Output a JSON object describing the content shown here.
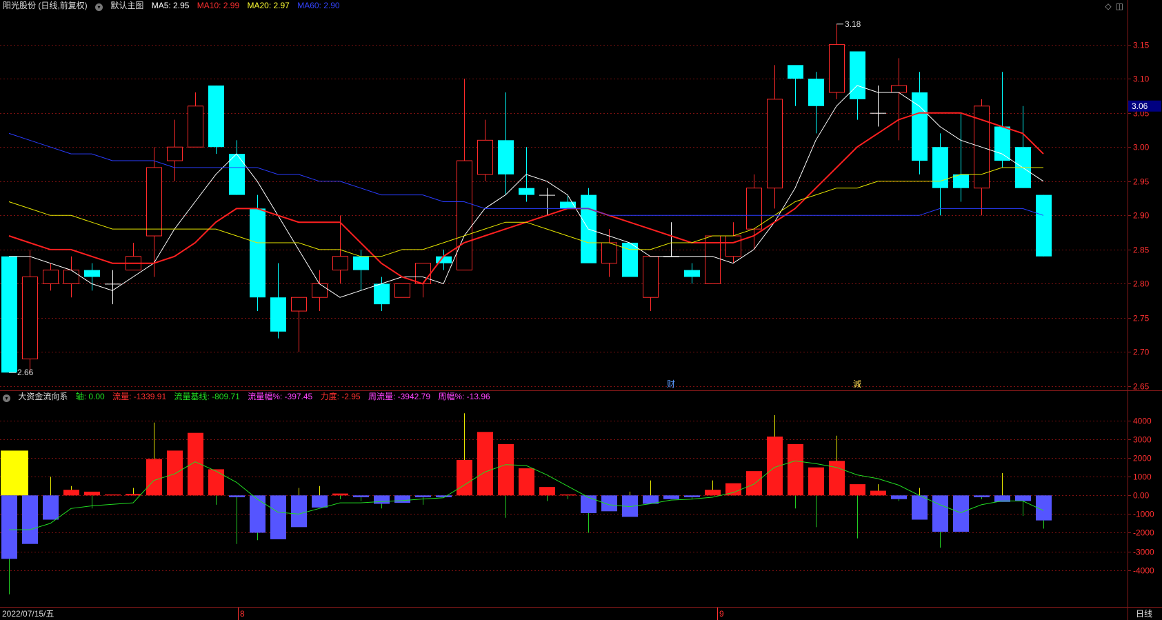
{
  "header": {
    "stock_label": "阳光股份 (日线,前复权)",
    "main_label": "默认主图",
    "ma5": "MA5: 2.95",
    "ma10": "MA10: 2.99",
    "ma20": "MA20: 2.97",
    "ma60": "MA60: 2.90"
  },
  "sub_header": {
    "title": "大资金流向系",
    "axis": "轴: 0.00",
    "flow": "流量: -1339.91",
    "baseline": "流量基线: -809.71",
    "flow_pct": "流量幅%: -397.45",
    "strength": "力度: -2.95",
    "weekly_flow": "周流量: -3942.79",
    "weekly_pct": "周幅%: -13.96"
  },
  "colors": {
    "up": "#ff2a2a",
    "down": "#00ffff",
    "ma5": "#ffffff",
    "ma10": "#ff2020",
    "ma20": "#e6e600",
    "ma60": "#2a3cff",
    "flow_pos": "#ff1a1a",
    "flow_neg": "#5555ff",
    "baseline": "#22dd22",
    "grid": "#7a1010"
  },
  "chart_data": [
    {
      "type": "candlestick",
      "yticks": [
        "3.15",
        "3.10",
        "3.05",
        "3.00",
        "2.95",
        "2.90",
        "2.85",
        "2.80",
        "2.75",
        "2.70",
        "2.65"
      ],
      "ylim": [
        2.645,
        3.195
      ],
      "current_price": "3.06",
      "high_marker": "3.18",
      "low_marker": "2.66",
      "event_labels": [
        {
          "index": 32,
          "text": "财"
        },
        {
          "index": 41,
          "text": "減"
        }
      ],
      "candles": [
        [
          2.84,
          2.84,
          2.67,
          2.67
        ],
        [
          2.69,
          2.85,
          2.67,
          2.81
        ],
        [
          2.8,
          2.83,
          2.79,
          2.82
        ],
        [
          2.8,
          2.84,
          2.78,
          2.82
        ],
        [
          2.82,
          2.83,
          2.79,
          2.81
        ],
        [
          2.8,
          2.82,
          2.77,
          2.8
        ],
        [
          2.82,
          2.86,
          2.82,
          2.84
        ],
        [
          2.87,
          3.0,
          2.81,
          2.97
        ],
        [
          2.98,
          3.04,
          2.95,
          3.0
        ],
        [
          3.0,
          3.08,
          3.0,
          3.06
        ],
        [
          3.09,
          3.09,
          2.99,
          3.0
        ],
        [
          2.99,
          3.01,
          2.93,
          2.93
        ],
        [
          2.91,
          2.93,
          2.76,
          2.78
        ],
        [
          2.78,
          2.83,
          2.72,
          2.73
        ],
        [
          2.76,
          2.78,
          2.7,
          2.78
        ],
        [
          2.78,
          2.82,
          2.76,
          2.8
        ],
        [
          2.82,
          2.9,
          2.8,
          2.84
        ],
        [
          2.84,
          2.85,
          2.79,
          2.82
        ],
        [
          2.8,
          2.81,
          2.76,
          2.77
        ],
        [
          2.78,
          2.8,
          2.78,
          2.8
        ],
        [
          2.8,
          2.83,
          2.78,
          2.83
        ],
        [
          2.84,
          2.85,
          2.82,
          2.83
        ],
        [
          2.82,
          3.1,
          2.82,
          2.98
        ],
        [
          2.96,
          3.04,
          2.95,
          3.01
        ],
        [
          3.01,
          3.08,
          2.93,
          2.96
        ],
        [
          2.94,
          3.0,
          2.92,
          2.93
        ],
        [
          2.93,
          2.94,
          2.9,
          2.93
        ],
        [
          2.92,
          2.93,
          2.91,
          2.91
        ],
        [
          2.93,
          2.94,
          2.91,
          2.83
        ],
        [
          2.83,
          2.88,
          2.81,
          2.86
        ],
        [
          2.86,
          2.86,
          2.81,
          2.81
        ],
        [
          2.78,
          2.84,
          2.76,
          2.84
        ],
        [
          2.84,
          2.89,
          2.84,
          2.84
        ],
        [
          2.82,
          2.83,
          2.8,
          2.81
        ],
        [
          2.8,
          2.84,
          2.8,
          2.87
        ],
        [
          2.84,
          2.89,
          2.83,
          2.87
        ],
        [
          2.88,
          2.96,
          2.85,
          2.94
        ],
        [
          2.94,
          3.12,
          2.91,
          3.07
        ],
        [
          3.12,
          3.11,
          3.06,
          3.1
        ],
        [
          3.1,
          3.11,
          3.02,
          3.06
        ],
        [
          3.08,
          3.18,
          3.07,
          3.15
        ],
        [
          3.14,
          3.14,
          3.04,
          3.07
        ],
        [
          3.05,
          3.09,
          3.03,
          3.05
        ],
        [
          3.08,
          3.13,
          3.01,
          3.09
        ],
        [
          3.08,
          3.11,
          2.96,
          2.98
        ],
        [
          3.0,
          3.02,
          2.9,
          2.94
        ],
        [
          2.96,
          3.05,
          2.92,
          2.94
        ],
        [
          2.94,
          3.07,
          2.9,
          3.06
        ],
        [
          3.03,
          3.11,
          2.97,
          2.98
        ],
        [
          3.0,
          3.06,
          2.94,
          2.94
        ],
        [
          2.93,
          2.93,
          2.84,
          2.84
        ]
      ],
      "series": [
        {
          "name": "MA5",
          "values": [
            2.84,
            2.84,
            2.83,
            2.82,
            2.8,
            2.79,
            2.81,
            2.83,
            2.88,
            2.92,
            2.96,
            2.99,
            2.95,
            2.9,
            2.85,
            2.8,
            2.78,
            2.79,
            2.8,
            2.81,
            2.81,
            2.8,
            2.87,
            2.91,
            2.93,
            2.96,
            2.95,
            2.93,
            2.88,
            2.87,
            2.86,
            2.84,
            2.84,
            2.84,
            2.84,
            2.83,
            2.85,
            2.89,
            2.94,
            3.01,
            3.06,
            3.09,
            3.08,
            3.08,
            3.06,
            3.03,
            3.01,
            3.0,
            2.99,
            2.97,
            2.95
          ]
        },
        {
          "name": "MA10",
          "values": [
            2.87,
            2.86,
            2.85,
            2.85,
            2.84,
            2.83,
            2.83,
            2.83,
            2.84,
            2.86,
            2.89,
            2.91,
            2.91,
            2.9,
            2.89,
            2.89,
            2.89,
            2.86,
            2.83,
            2.81,
            2.8,
            2.84,
            2.86,
            2.87,
            2.88,
            2.89,
            2.9,
            2.91,
            2.91,
            2.9,
            2.89,
            2.88,
            2.87,
            2.86,
            2.86,
            2.86,
            2.87,
            2.89,
            2.91,
            2.94,
            2.97,
            3.0,
            3.02,
            3.04,
            3.05,
            3.05,
            3.05,
            3.04,
            3.03,
            3.02,
            2.99
          ]
        },
        {
          "name": "MA20",
          "values": [
            2.92,
            2.91,
            2.9,
            2.9,
            2.89,
            2.88,
            2.88,
            2.88,
            2.88,
            2.88,
            2.88,
            2.87,
            2.86,
            2.86,
            2.86,
            2.85,
            2.85,
            2.84,
            2.84,
            2.85,
            2.85,
            2.86,
            2.87,
            2.88,
            2.89,
            2.89,
            2.88,
            2.87,
            2.86,
            2.86,
            2.85,
            2.85,
            2.86,
            2.86,
            2.87,
            2.87,
            2.88,
            2.9,
            2.92,
            2.93,
            2.94,
            2.94,
            2.95,
            2.95,
            2.95,
            2.95,
            2.96,
            2.96,
            2.97,
            2.97,
            2.97
          ]
        },
        {
          "name": "MA60",
          "values": [
            3.02,
            3.01,
            3.0,
            2.99,
            2.99,
            2.98,
            2.98,
            2.98,
            2.97,
            2.97,
            2.97,
            2.97,
            2.97,
            2.96,
            2.96,
            2.95,
            2.95,
            2.94,
            2.93,
            2.93,
            2.93,
            2.92,
            2.92,
            2.91,
            2.91,
            2.91,
            2.91,
            2.91,
            2.91,
            2.9,
            2.9,
            2.9,
            2.9,
            2.9,
            2.9,
            2.9,
            2.9,
            2.9,
            2.9,
            2.9,
            2.9,
            2.9,
            2.9,
            2.9,
            2.9,
            2.91,
            2.91,
            2.91,
            2.91,
            2.91,
            2.9
          ]
        }
      ]
    },
    {
      "type": "bar",
      "yticks": [
        "4000",
        "3000",
        "2000",
        "1000",
        "0.00",
        "-1000",
        "-2000",
        "-3000",
        "-4000"
      ],
      "ylim": [
        -5900,
        5000
      ],
      "flow": [
        -3400,
        -2600,
        -1300,
        300,
        200,
        50,
        80,
        1950,
        2400,
        3350,
        1400,
        -100,
        -2000,
        -2350,
        -1700,
        -650,
        100,
        -100,
        -450,
        -400,
        -100,
        -100,
        1900,
        3400,
        2750,
        1450,
        450,
        50,
        -950,
        -850,
        -1150,
        -450,
        -200,
        -100,
        300,
        650,
        1300,
        3150,
        2750,
        1500,
        1850,
        600,
        250,
        -200,
        -1300,
        -1950,
        -1950,
        -100,
        -350,
        -300,
        -1340
      ],
      "signal_lines": [
        -5300,
        -1500,
        1000,
        500,
        -700,
        0,
        400,
        3900,
        800,
        1200,
        -500,
        -2600,
        -2400,
        -1600,
        400,
        500,
        -200,
        -300,
        -700,
        -150,
        -500,
        -100,
        4400,
        2900,
        -1200,
        800,
        -300,
        -200,
        -2000,
        -300,
        200,
        800,
        -200,
        -200,
        800,
        400,
        300,
        4300,
        -700,
        -1700,
        3200,
        -2300,
        600,
        -300,
        400,
        -2800,
        -400,
        -200,
        1200,
        -1100,
        -1780
      ],
      "baseline": [
        -1840,
        -1840,
        -1500,
        -700,
        -560,
        -480,
        -400,
        800,
        1150,
        1800,
        1300,
        700,
        -200,
        -900,
        -1000,
        -700,
        -400,
        -400,
        -330,
        -280,
        -190,
        -130,
        550,
        1250,
        1650,
        1600,
        1100,
        500,
        -100,
        -500,
        -600,
        -450,
        -250,
        -200,
        -100,
        150,
        600,
        1500,
        1850,
        1700,
        1500,
        1100,
        900,
        550,
        0,
        -500,
        -930,
        -500,
        -300,
        -300,
        -810
      ],
      "signal_block": 2400,
      "xaxis": {
        "date": "2022/07/15/五",
        "mark_8": "8",
        "mark_9": "9",
        "period": "日线"
      }
    }
  ]
}
